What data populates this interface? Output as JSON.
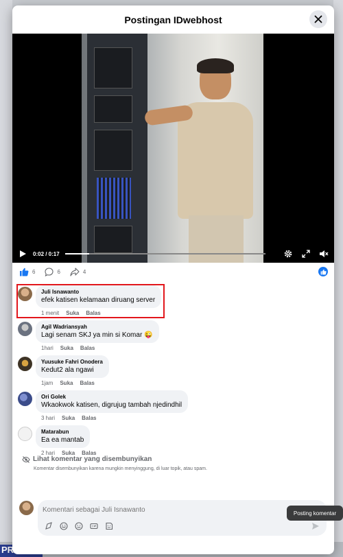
{
  "modal": {
    "title": "Postingan IDwebhost"
  },
  "video": {
    "current_time": "0:02",
    "duration": "0:17",
    "time_display": "0:02 / 0:17",
    "progress_fraction": 0.12
  },
  "reactions": {
    "likes": "6",
    "comments": "6",
    "shares": "4"
  },
  "comments": [
    {
      "name": "Juli Isnawanto",
      "text": "efek katisen kelamaan diruang server",
      "time": "1 menit",
      "like": "Suka",
      "reply": "Balas",
      "avatar_color": "#8a6a4a"
    },
    {
      "name": "Agil Wadriansyah",
      "text": "Lagi senam SKJ ya min si Komar 😜",
      "time": "1hari",
      "like": "Suka",
      "reply": "Balas",
      "avatar_color": "#6b7280"
    },
    {
      "name": "Yuusuke Fahri Onodera",
      "text": "Kedut2 ala ngawi",
      "time": "1jam",
      "like": "Suka",
      "reply": "Balas",
      "avatar_color": "#3d3325"
    },
    {
      "name": "Ori Golek",
      "text": "Wkaokwok katisen, digrujug tambah njedindhil",
      "time": "3 hari",
      "like": "Suka",
      "reply": "Balas",
      "avatar_color": "#3b4c8a"
    },
    {
      "name": "Matarabun",
      "text": "Ea ea mantab",
      "time": "2 hari",
      "like": "Suka",
      "reply": "Balas",
      "avatar_color": "#e8e8e8"
    }
  ],
  "hidden_comments": {
    "title": "Lihat komentar yang disembunyikan",
    "description": "Komentar disembunyikan karena mungkin menyinggung, di luar topik, atau spam."
  },
  "composer": {
    "placeholder": "Komentari sebagai Juli Isnawanto"
  },
  "tooltip": {
    "text": "Posting komentar"
  },
  "background": {
    "promo": "PROMO"
  },
  "colors": {
    "accent": "#1877f2",
    "highlight": "#e2161b"
  }
}
